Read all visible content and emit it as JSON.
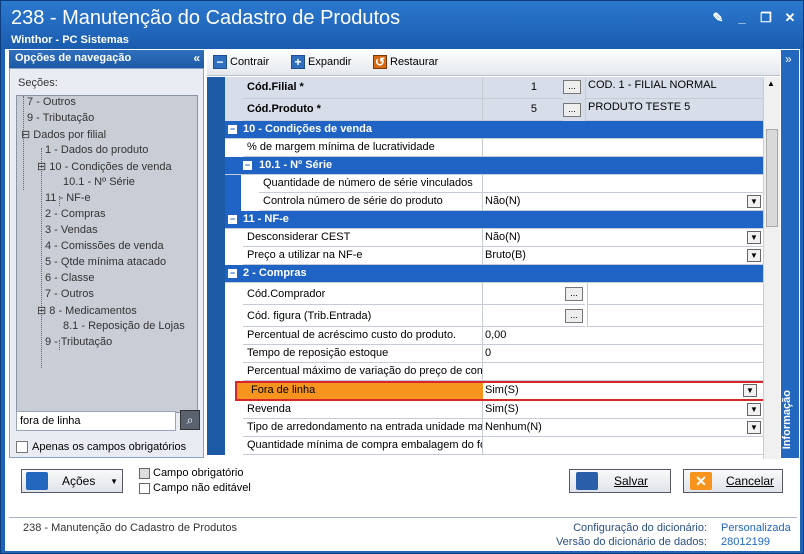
{
  "window": {
    "title": "238 - Manutenção do Cadastro de Produtos",
    "subtitle": "Winthor - PC Sistemas"
  },
  "nav": {
    "header": "Opções de navegação",
    "sections_label": "Seções:",
    "tree": [
      "7 - Outros",
      "9 - Tributação",
      "Dados por filial",
      "1 - Dados do produto",
      "10 - Condições de venda",
      "10.1 - Nº Série",
      "11 - NF-e",
      "2 - Compras",
      "3 - Vendas",
      "4 - Comissões de venda",
      "5 - Qtde mínima atacado",
      "6 - Classe",
      "7 - Outros",
      "8 - Medicamentos",
      "8.1 - Reposição de Lojas",
      "9 - Tributação"
    ],
    "search_value": "fora de linha",
    "only_required_label": "Apenas os campos obrigatórios"
  },
  "toolbar": {
    "collapse": "Contrair",
    "expand": "Expandir",
    "restore": "Restaurar"
  },
  "grid": {
    "filial_label": "Cód.Filial *",
    "filial_value": "1",
    "filial_desc": "COD. 1 - FILIAL NORMAL",
    "produto_label": "Cód.Produto *",
    "produto_value": "5",
    "produto_desc": "PRODUTO TESTE 5",
    "cat10": "10 - Condições de venda",
    "margem": "% de margem mínima de lucratividade",
    "cat101": "10.1 - Nº Série",
    "qtd_serie": "Quantidade de número de série vinculados",
    "ctrl_serie": "Controla número de série do produto",
    "ctrl_serie_v": "Não(N)",
    "cat11": "11 - NF-e",
    "cest": "Desconsiderar CEST",
    "cest_v": "Não(N)",
    "preco": "Preço a utilizar na NF-e",
    "preco_v": "Bruto(B)",
    "cat2": "2 - Compras",
    "comprador": "Cód.Comprador",
    "figura": "Cód. figura (Trib.Entrada)",
    "acresc": "Percentual de acréscimo custo do produto.",
    "acresc_v": "0,00",
    "repos": "Tempo de reposição estoque",
    "repos_v": "0",
    "varia": "Percentual máximo de variação do preço de com",
    "fora": "Fora de linha",
    "fora_v": "Sim(S)",
    "revenda": "Revenda",
    "revenda_v": "Sim(S)",
    "arred": "Tipo de arredondamento na entrada unidade ma",
    "arred_v": "Nenhum(N)",
    "qtdmin": "Quantidade mínima de compra embalagem do fo"
  },
  "info_tab": "Informação",
  "bottom": {
    "acoes": "Ações",
    "campo_obrig": "Campo obrigatório",
    "campo_nao_edit": "Campo não editável",
    "salvar": "Salvar",
    "cancelar": "Cancelar"
  },
  "status": {
    "routine": "238 - Manutenção do Cadastro de Produtos",
    "config_label": "Configuração do dicionário:",
    "config_value": "Personalizada",
    "version_label": "Versão do dicionário de dados:",
    "version_value": "28012199"
  },
  "colors": {
    "accent": "#1f63c4",
    "highlight": "#f7941d",
    "brand": "#1e63b6"
  }
}
